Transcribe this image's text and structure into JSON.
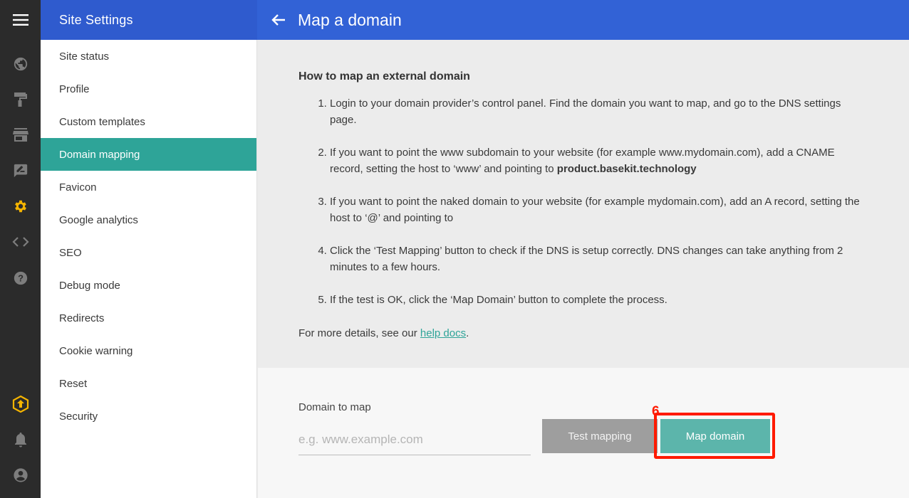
{
  "sidebar": {
    "title": "Site Settings",
    "items": [
      {
        "label": "Site status"
      },
      {
        "label": "Profile"
      },
      {
        "label": "Custom templates"
      },
      {
        "label": "Domain mapping"
      },
      {
        "label": "Favicon"
      },
      {
        "label": "Google analytics"
      },
      {
        "label": "SEO"
      },
      {
        "label": "Debug mode"
      },
      {
        "label": "Redirects"
      },
      {
        "label": "Cookie warning"
      },
      {
        "label": "Reset"
      },
      {
        "label": "Security"
      }
    ],
    "active_item": "Domain mapping"
  },
  "rail": {
    "icons": [
      "menu-icon",
      "globe-icon",
      "paint-roller-icon",
      "store-icon",
      "feedback-icon",
      "gear-icon",
      "code-icon",
      "help-icon",
      "upgrade-icon",
      "bell-icon",
      "account-icon"
    ],
    "active_icon": "gear-icon",
    "accent_color": "#f5b400"
  },
  "header": {
    "title": "Map a domain",
    "back_icon": "arrow-back-icon"
  },
  "instructions": {
    "heading": "How to map an external domain",
    "step1": "Login to your domain provider’s control panel. Find the domain you want to map, and go to the DNS settings page.",
    "step2_text": "If you want to point the www subdomain to your website (for example www.mydomain.com), add a CNAME record, setting the host to ‘www’ and pointing to ",
    "step2_target": "product.basekit.technology",
    "step3": "If you want to point the naked domain to your website (for example mydomain.com), add an A record, setting the host to ‘@’ and pointing to",
    "step4": "Click the ‘Test Mapping’ button to check if the DNS is setup correctly. DNS changes can take anything from 2 minutes to a few hours.",
    "step5": "If the test is OK, click the ‘Map Domain’ button to complete the process.",
    "more_prefix": "For more details, see our ",
    "more_link": "help docs",
    "more_suffix": "."
  },
  "form": {
    "label": "Domain to map",
    "placeholder": "e.g. www.example.com",
    "value": "",
    "test_button": "Test mapping",
    "map_button": "Map domain"
  },
  "annotation": {
    "step_number": "6",
    "color": "#ff1a00"
  },
  "colors": {
    "header_blue": "#3262d6",
    "sidebar_header_blue": "#2f5bce",
    "active_teal": "#2ea498",
    "map_button": "#5cb5ab",
    "test_button": "#9e9e9e"
  }
}
